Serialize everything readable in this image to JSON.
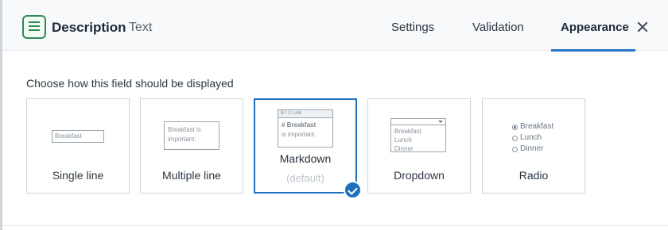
{
  "header": {
    "title": "Description",
    "subtitle": "Text",
    "field_icon": "text-lines-icon",
    "close_icon": "close-icon",
    "tabs": [
      {
        "label": "Settings",
        "active": false
      },
      {
        "label": "Validation",
        "active": false
      },
      {
        "label": "Appearance",
        "active": true
      }
    ]
  },
  "main": {
    "prompt": "Choose how this field should be displayed",
    "options": [
      {
        "label": "Single line",
        "preview_text": "Breakfast",
        "selected": false
      },
      {
        "label": "Multiple line",
        "preview_lines": [
          "Breakfast is",
          "important."
        ],
        "selected": false
      },
      {
        "label": "Markdown",
        "note": "(default)",
        "preview_toolbar": "B  I  U  Link",
        "preview_lines": [
          "# Breakfast",
          "is important."
        ],
        "selected": true
      },
      {
        "label": "Dropdown",
        "preview_items": [
          "Breakfast",
          "Lunch",
          "Dinner"
        ],
        "selected": false
      },
      {
        "label": "Radio",
        "preview_items": [
          "Breakfast",
          "Lunch",
          "Dinner"
        ],
        "selected": false
      }
    ],
    "selected_badge_icon": "check-circle-icon"
  },
  "colors": {
    "accent": "#1f6fbf",
    "icon_green": "#2e8b57",
    "header_bg": "#f7f9fa"
  }
}
